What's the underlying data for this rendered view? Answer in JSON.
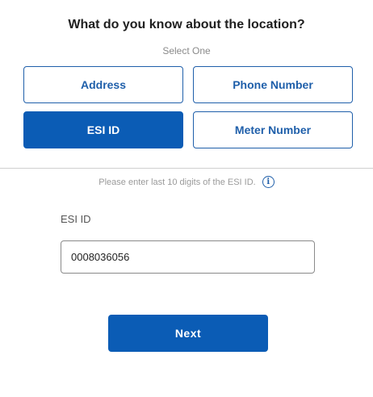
{
  "header": {
    "title": "What do you know about the location?",
    "subtitle": "Select One"
  },
  "options": [
    {
      "label": "Address",
      "selected": false
    },
    {
      "label": "Phone Number",
      "selected": false
    },
    {
      "label": "ESI ID",
      "selected": true
    },
    {
      "label": "Meter Number",
      "selected": false
    }
  ],
  "hint": {
    "text": "Please enter last 10 digits of the ESI ID.",
    "icon": "info-icon"
  },
  "esi_field": {
    "label": "ESI ID",
    "value": "0008036056"
  },
  "next_button": {
    "label": "Next"
  },
  "colors": {
    "accent": "#0b5cb5",
    "outline": "#1f5faa"
  }
}
